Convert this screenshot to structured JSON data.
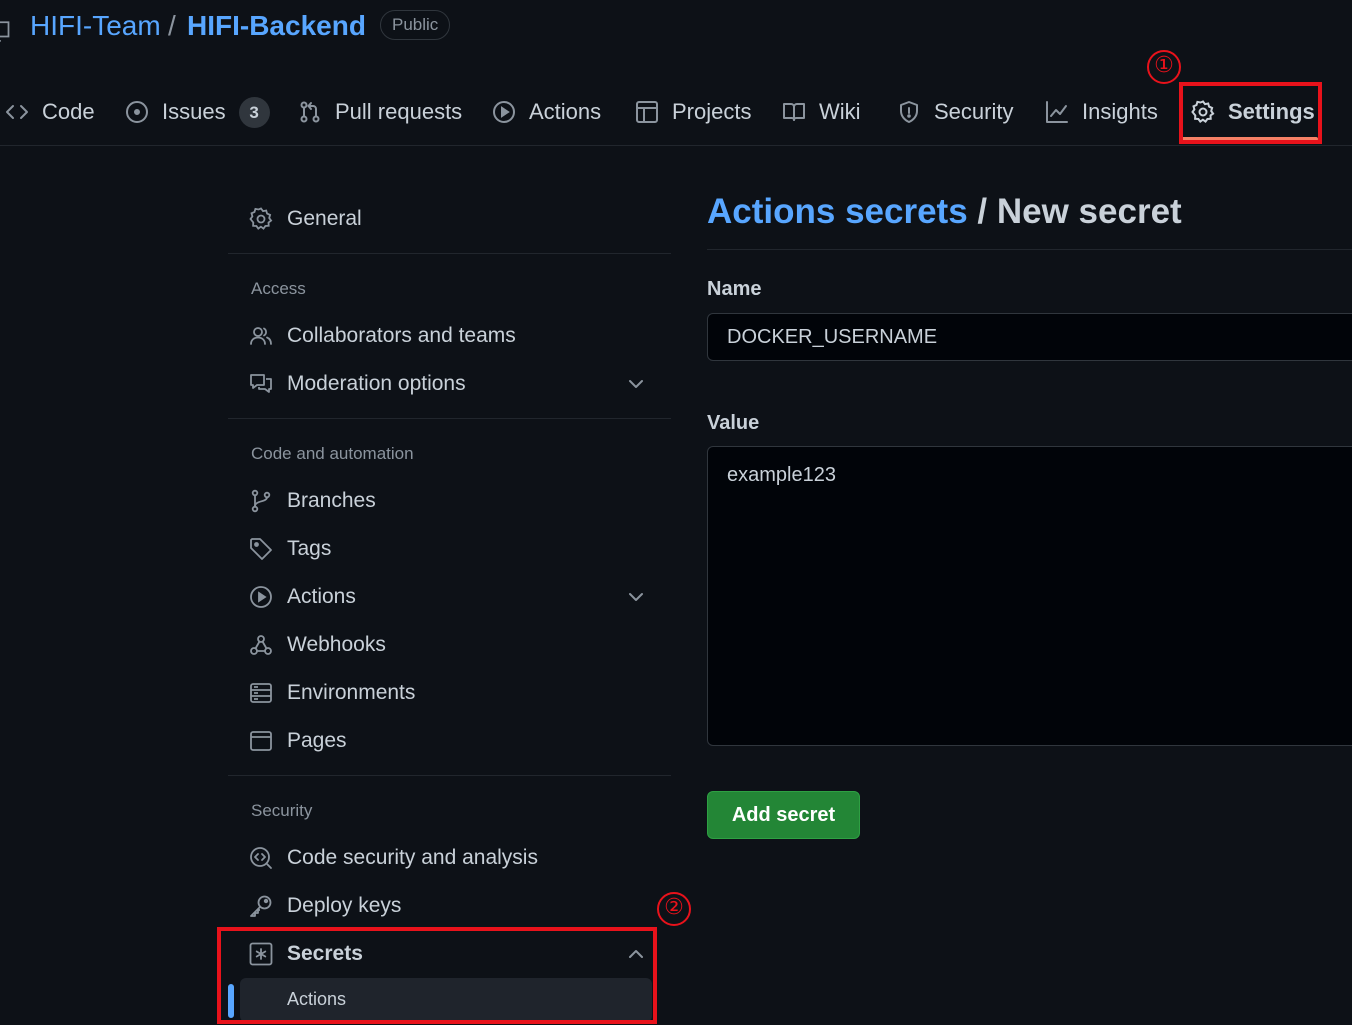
{
  "repo": {
    "owner": "HIFI-Team",
    "separator": "/",
    "name": "HIFI-Backend",
    "visibility": "Public"
  },
  "tabs": [
    {
      "label": "Code",
      "icon": "code-icon"
    },
    {
      "label": "Issues",
      "icon": "issue-opened-icon",
      "counter": "3"
    },
    {
      "label": "Pull requests",
      "icon": "git-pull-request-icon"
    },
    {
      "label": "Actions",
      "icon": "play-icon"
    },
    {
      "label": "Projects",
      "icon": "table-icon"
    },
    {
      "label": "Wiki",
      "icon": "book-icon"
    },
    {
      "label": "Security",
      "icon": "shield-icon"
    },
    {
      "label": "Insights",
      "icon": "graph-icon"
    },
    {
      "label": "Settings",
      "icon": "gear-icon",
      "selected": true
    }
  ],
  "annotations": {
    "marker_1": "①",
    "marker_2": "②",
    "color": "#e8121b"
  },
  "sidebar": {
    "general": "General",
    "access_heading": "Access",
    "collaborators": "Collaborators and teams",
    "moderation": "Moderation options",
    "code_heading": "Code and automation",
    "branches": "Branches",
    "tags": "Tags",
    "actions": "Actions",
    "webhooks": "Webhooks",
    "environments": "Environments",
    "pages": "Pages",
    "security_heading": "Security",
    "code_security": "Code security and analysis",
    "deploy_keys": "Deploy keys",
    "secrets": "Secrets",
    "secrets_actions": "Actions"
  },
  "main": {
    "heading_link": "Actions secrets",
    "heading_separator": " / ",
    "heading_current": "New secret",
    "name_label": "Name",
    "name_value": "DOCKER_USERNAME",
    "value_label": "Value",
    "value_value": "example123",
    "submit_label": "Add secret"
  },
  "colors": {
    "background": "#0d1117",
    "link": "#58a6ff",
    "primary_button": "#238636",
    "selected_tab_underline": "#f78166"
  }
}
